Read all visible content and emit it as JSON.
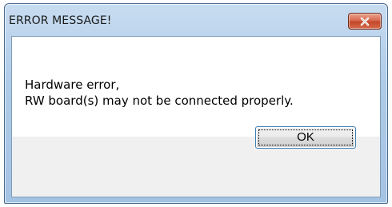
{
  "dialog": {
    "title": "ERROR MESSAGE!",
    "close_icon": "close-x-icon",
    "message_lines": [
      "Hardware error,",
      "RW board(s) may not be connected properly."
    ],
    "ok_label": "OK"
  },
  "colors": {
    "titlebar": "#aecbe8",
    "close_button": "#c4472a",
    "content_background": "#ffffff",
    "button_area_background": "#f0f0f0"
  }
}
